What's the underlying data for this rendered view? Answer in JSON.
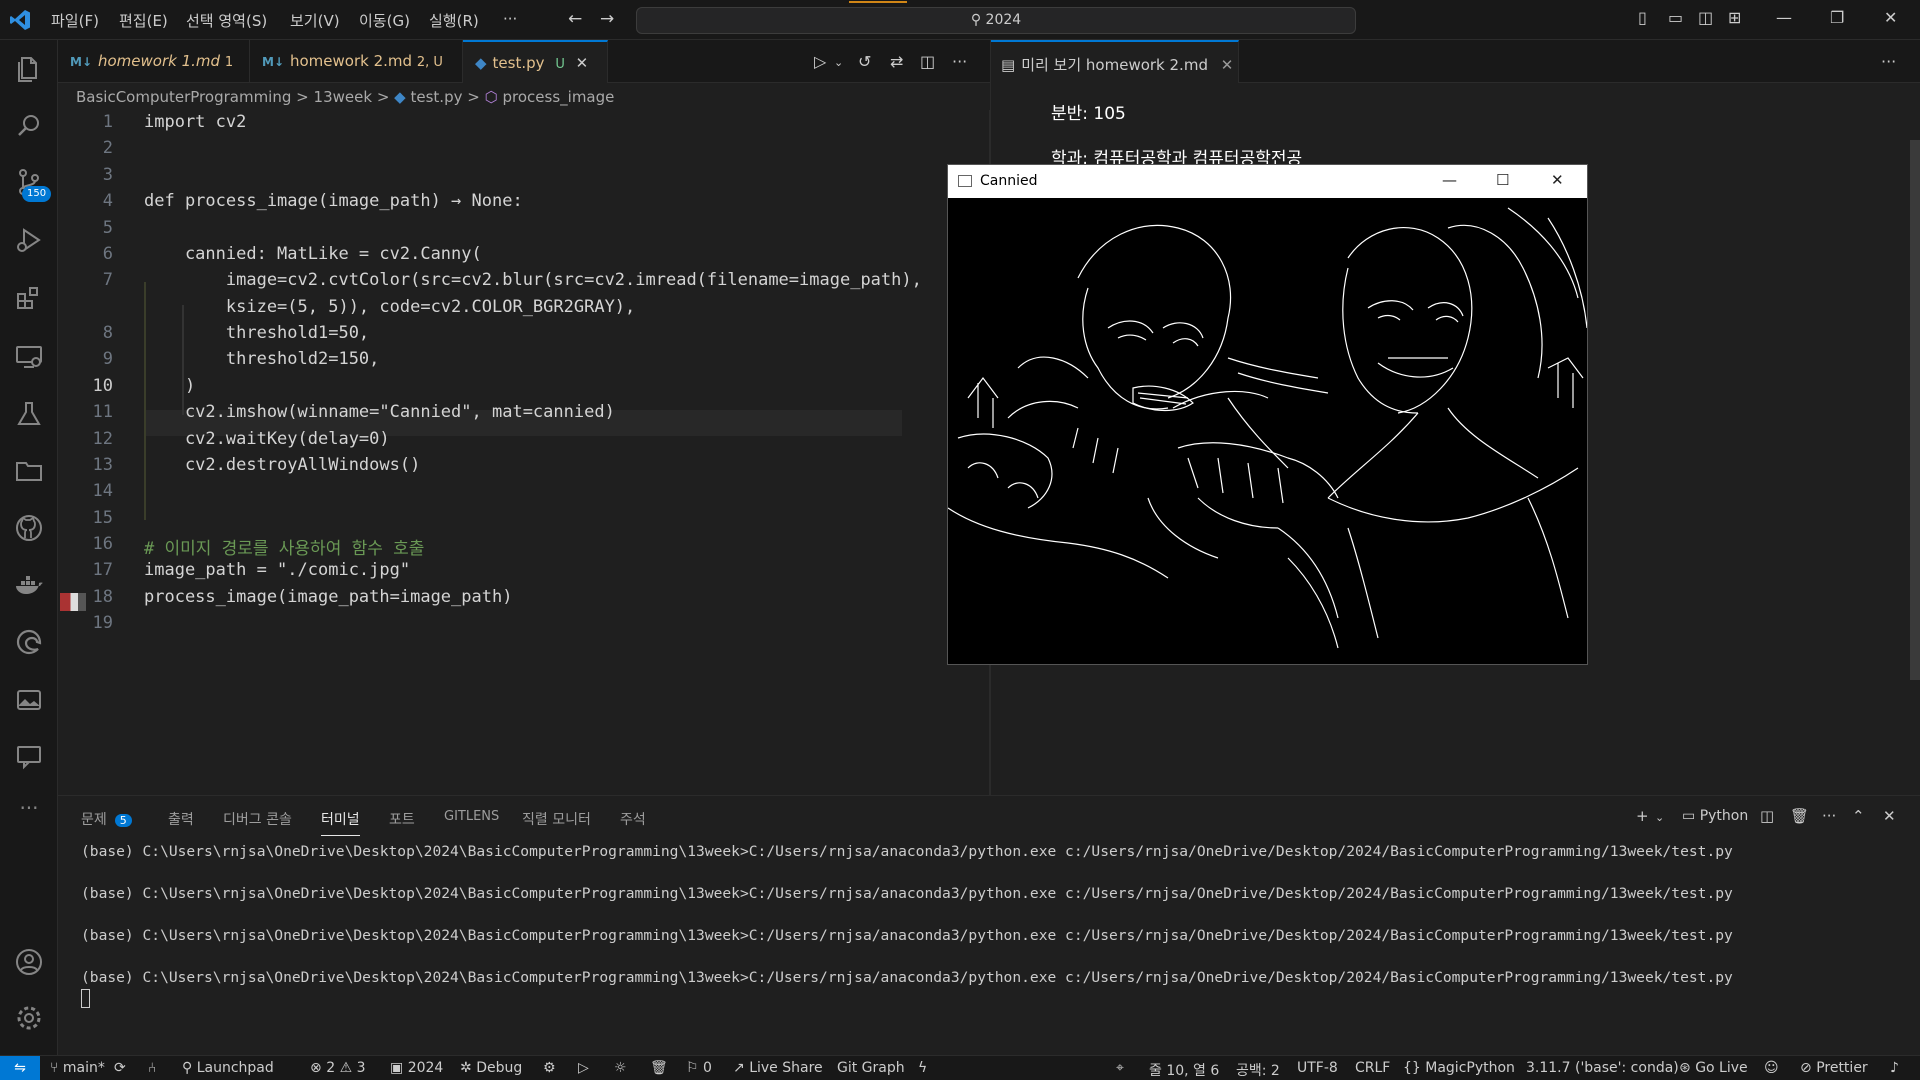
{
  "menu": [
    "파일(F)",
    "편집(E)",
    "선택 영역(S)",
    "보기(V)",
    "이동(G)",
    "실행(R)",
    "···"
  ],
  "command_center": "2024",
  "activity_badge": "150",
  "tabs": [
    {
      "label": "homework 1.md",
      "status": "1"
    },
    {
      "label": "homework 2.md",
      "status": "2, U"
    },
    {
      "label": "test.py",
      "status": "U"
    }
  ],
  "preview_tab": "미리 보기 homework 2.md",
  "breadcrumb": [
    "BasicComputerProgramming",
    ">",
    "13week",
    ">",
    "test.py",
    ">",
    "process_image"
  ],
  "code_lines": [
    {
      "n": "1",
      "text": "import cv2"
    },
    {
      "n": "2",
      "text": ""
    },
    {
      "n": "3",
      "text": ""
    },
    {
      "n": "4",
      "text": "def process_image(image_path) → None:"
    },
    {
      "n": "5",
      "text": ""
    },
    {
      "n": "6",
      "text": "    cannied: MatLike = cv2.Canny("
    },
    {
      "n": "7",
      "text": "        image=cv2.cvtColor(src=cv2.blur(src=cv2.imread(filename=image_path),"
    },
    {
      "n": "",
      "text": "        ksize=(5, 5)), code=cv2.COLOR_BGR2GRAY),"
    },
    {
      "n": "8",
      "text": "        threshold1=50,"
    },
    {
      "n": "9",
      "text": "        threshold2=150,"
    },
    {
      "n": "10",
      "text": "    )"
    },
    {
      "n": "11",
      "text": "    cv2.imshow(winname=\"Cannied\", mat=cannied)"
    },
    {
      "n": "12",
      "text": "    cv2.waitKey(delay=0)"
    },
    {
      "n": "13",
      "text": "    cv2.destroyAllWindows()"
    },
    {
      "n": "14",
      "text": ""
    },
    {
      "n": "15",
      "text": ""
    },
    {
      "n": "16",
      "text": "# 이미지 경로를 사용하여 함수 호출"
    },
    {
      "n": "17",
      "text": "image_path = \"./comic.jpg\""
    },
    {
      "n": "18",
      "text": "process_image(image_path=image_path)"
    },
    {
      "n": "19",
      "text": ""
    }
  ],
  "preview": {
    "line1": "분반: 105",
    "line2": "학과: 컴퓨터공학과 컴퓨터공학전공"
  },
  "cv_window": {
    "title": "Cannied",
    "min": "—",
    "max": "☐",
    "close": "✕"
  },
  "panel_tabs": [
    {
      "label": "문제",
      "badge": "5"
    },
    {
      "label": "출력"
    },
    {
      "label": "디버그 콘솔"
    },
    {
      "label": "터미널"
    },
    {
      "label": "포트"
    },
    {
      "label": "GITLENS"
    },
    {
      "label": "직렬 모니터"
    },
    {
      "label": "주석"
    }
  ],
  "terminal_profile": "Python",
  "terminal_lines": [
    "(base) C:\\Users\\rnjsa\\OneDrive\\Desktop\\2024\\BasicComputerProgramming\\13week>C:/Users/rnjsa/anaconda3/python.exe c:/Users/rnjsa/OneDrive/Desktop/2024/BasicComputerProgramming/13week/test.py",
    "(base) C:\\Users\\rnjsa\\OneDrive\\Desktop\\2024\\BasicComputerProgramming\\13week>C:/Users/rnjsa/anaconda3/python.exe c:/Users/rnjsa/OneDrive/Desktop/2024/BasicComputerProgramming/13week/test.py",
    "(base) C:\\Users\\rnjsa\\OneDrive\\Desktop\\2024\\BasicComputerProgramming\\13week>C:/Users/rnjsa/anaconda3/python.exe c:/Users/rnjsa/OneDrive/Desktop/2024/BasicComputerProgramming/13week/test.py",
    "(base) C:\\Users\\rnjsa\\OneDrive\\Desktop\\2024\\BasicComputerProgramming\\13week>C:/Users/rnjsa/anaconda3/python.exe c:/Users/rnjsa/OneDrive/Desktop/2024/BasicComputerProgramming/13week/test.py"
  ],
  "status": {
    "branch": "main*",
    "launchpad": "Launchpad",
    "errors": "2",
    "warnings": "3",
    "folder": "2024",
    "debug": "Debug",
    "ports": "0",
    "liveshare": "Live Share",
    "gitgraph": "Git Graph",
    "position": "줄 10, 열 6",
    "spaces": "공백: 2",
    "encoding": "UTF-8",
    "eol": "CRLF",
    "language": "MagicPython",
    "interpreter": "3.11.7 ('base': conda)",
    "golive": "Go Live",
    "prettier": "Prettier"
  }
}
